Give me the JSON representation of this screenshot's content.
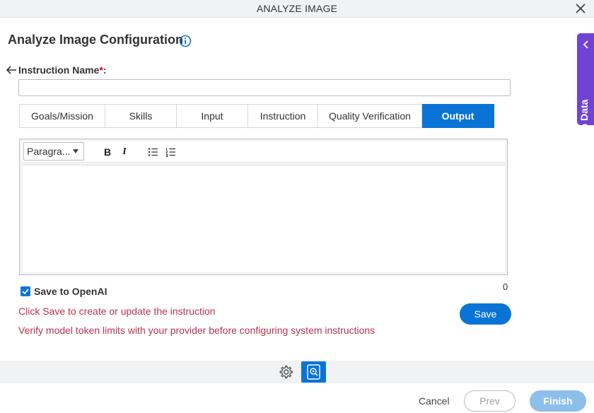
{
  "window": {
    "title": "ANALYZE IMAGE",
    "close_icon": "close-icon"
  },
  "header": {
    "title": "Analyze Image Configuration",
    "info_icon": "info-icon"
  },
  "side_panel": {
    "label": "App Data",
    "icon": "chevron-left-icon",
    "color": "#7142d6"
  },
  "form": {
    "instruction_name_label": "Instruction Name",
    "required_marker": "*",
    "label_suffix": ":",
    "instruction_name_value": ""
  },
  "tabs": [
    {
      "label": "Goals/Mission",
      "active": false
    },
    {
      "label": "Skills",
      "active": false
    },
    {
      "label": "Input",
      "active": false
    },
    {
      "label": "Instruction",
      "active": false
    },
    {
      "label": "Quality Verification",
      "active": false
    },
    {
      "label": "Output",
      "active": true
    }
  ],
  "editor": {
    "paragraph_select": "Paragra...",
    "bold": "B",
    "italic": "I",
    "bullet_list_icon": "bullet-list-icon",
    "numbered_list_icon": "numbered-list-icon",
    "content": "",
    "char_count": "0"
  },
  "save_to_openai": {
    "label": "Save to OpenAI",
    "checked": true
  },
  "messages": {
    "save_hint": "Click Save to create or update the instruction",
    "token_warning": "Verify model token limits with your provider before configuring system instructions"
  },
  "buttons": {
    "save": "Save",
    "cancel": "Cancel",
    "prev": "Prev",
    "finish": "Finish"
  },
  "colors": {
    "accent": "#0a74d6",
    "warning_text": "#b8334a",
    "required": "#d0021b"
  }
}
